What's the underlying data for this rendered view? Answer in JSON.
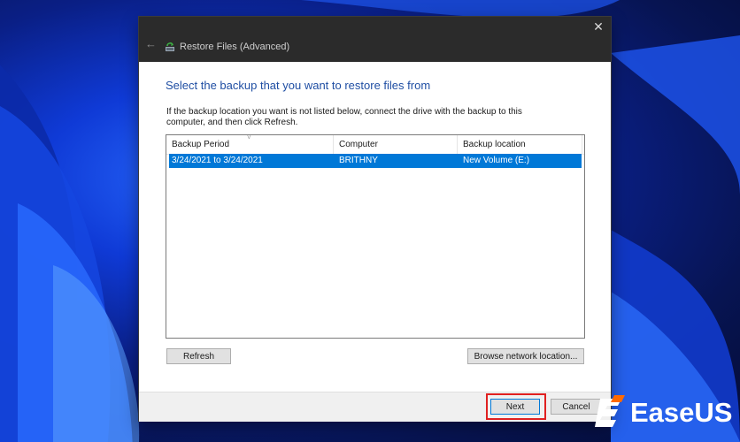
{
  "window": {
    "title": "Restore Files (Advanced)",
    "back_icon": "back-arrow-icon",
    "close_icon": "close-icon"
  },
  "main": {
    "heading": "Select the backup that you want to restore files from",
    "instructions": "If the backup location you want is not listed below, connect the drive with the backup to this computer, and then click Refresh.",
    "columns": [
      "Backup Period",
      "Computer",
      "Backup location"
    ],
    "rows": [
      {
        "period": "3/24/2021 to 3/24/2021",
        "computer": "BRITHNY",
        "location": "New Volume (E:)",
        "selected": true
      }
    ]
  },
  "buttons": {
    "refresh": "Refresh",
    "browse": "Browse network location...",
    "next": "Next",
    "cancel": "Cancel"
  },
  "watermark": {
    "brand": "EaseUS"
  },
  "colors": {
    "heading": "#1f4ea3",
    "selection": "#0078d7",
    "highlight": "#e02020",
    "titlebar": "#2b2b2b"
  }
}
